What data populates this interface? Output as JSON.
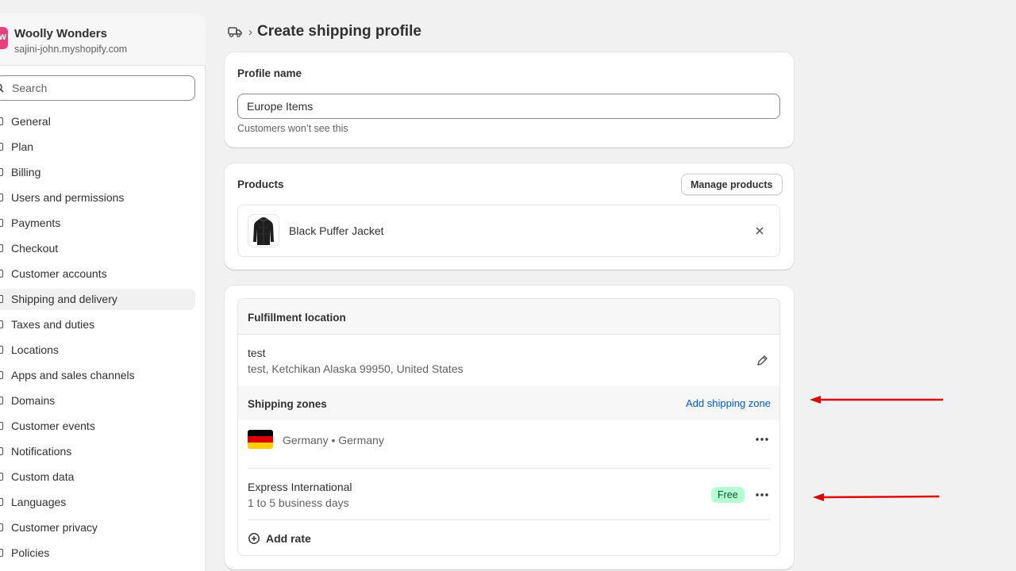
{
  "store": {
    "avatar_initial": "W",
    "name": "Woolly Wonders",
    "domain": "sajini-john.myshopify.com"
  },
  "search": {
    "placeholder": "Search"
  },
  "nav": {
    "items": [
      {
        "label": "General",
        "icon": "gear-icon"
      },
      {
        "label": "Plan",
        "icon": "plan-icon"
      },
      {
        "label": "Billing",
        "icon": "billing-icon"
      },
      {
        "label": "Users and permissions",
        "icon": "user-icon"
      },
      {
        "label": "Payments",
        "icon": "payments-icon"
      },
      {
        "label": "Checkout",
        "icon": "cart-icon"
      },
      {
        "label": "Customer accounts",
        "icon": "person-icon"
      },
      {
        "label": "Shipping and delivery",
        "icon": "truck-icon",
        "active": true
      },
      {
        "label": "Taxes and duties",
        "icon": "tax-icon"
      },
      {
        "label": "Locations",
        "icon": "location-icon"
      },
      {
        "label": "Apps and sales channels",
        "icon": "apps-icon"
      },
      {
        "label": "Domains",
        "icon": "globe-icon"
      },
      {
        "label": "Customer events",
        "icon": "events-icon"
      },
      {
        "label": "Notifications",
        "icon": "bell-icon"
      },
      {
        "label": "Custom data",
        "icon": "data-icon"
      },
      {
        "label": "Languages",
        "icon": "language-icon"
      },
      {
        "label": "Customer privacy",
        "icon": "lock-icon"
      },
      {
        "label": "Policies",
        "icon": "document-icon"
      }
    ]
  },
  "header": {
    "separator": "›",
    "title": "Create shipping profile"
  },
  "profile": {
    "label": "Profile name",
    "value": "Europe Items",
    "helper": "Customers won’t see this"
  },
  "products": {
    "label": "Products",
    "manage_button": "Manage products",
    "items": [
      {
        "name": "Black Puffer Jacket"
      }
    ]
  },
  "fulfillment": {
    "label": "Fulfillment location",
    "location_name": "test",
    "location_address": "test, Ketchikan Alaska 99950, United States",
    "zones_label": "Shipping zones",
    "add_zone": "Add shipping zone",
    "zone": {
      "name": "Germany • Germany"
    },
    "rate": {
      "name": "Express International",
      "days": "1 to 5 business days",
      "price": "Free"
    },
    "add_rate": "Add rate"
  },
  "colors": {
    "accent_link": "#005bd3",
    "badge_bg": "#b4fed2",
    "annotation_arrow": "#e00000",
    "avatar": "#e8407a"
  }
}
